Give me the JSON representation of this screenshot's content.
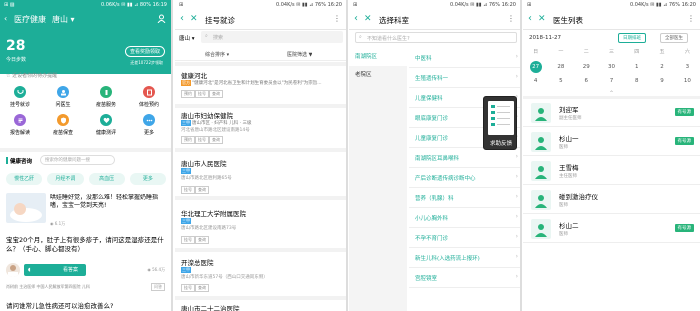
{
  "colors": {
    "teal": "#1dae98",
    "blue_tag": "#3fa6e8",
    "green": "#28b47a",
    "orange": "#f39a2d",
    "red": "#e4574f",
    "purple": "#9a67d7",
    "light_teal": "#e9f7f4"
  },
  "status_bar": {
    "p1": {
      "left": "⊞ ▨",
      "right": "0.06K/s ✉ ▮▮ ⊿ 80% 16:19"
    },
    "p2": {
      "left": "⊞",
      "right": "0.04K/s ✉ ▮▮ ⊿ 76% 16:20"
    },
    "p3": {
      "left": "⊞",
      "right": "0.04K/s ✉ ▮▮ ⊿ 76% 16:20"
    },
    "p4": {
      "left": "⊞",
      "right": "0.04K/s ✉ ▮▮ ⊿ 76% 16:20"
    }
  },
  "p1": {
    "title": "医疗健康",
    "city": "唐山",
    "temp": "28",
    "weather": "今日步数",
    "assistant_btn": "查看奖励领取",
    "assistant_sub": "还差10722步领取",
    "quick_label": "☆ 近设者你的待办提醒",
    "grid": [
      {
        "label": "挂号就诊",
        "icon": "stethoscope-icon"
      },
      {
        "label": "问医生",
        "icon": "doctor-icon"
      },
      {
        "label": "疫苗服务",
        "icon": "vaccine-icon"
      },
      {
        "label": "体检预约",
        "icon": "checkup-icon"
      },
      {
        "label": "报告解读",
        "icon": "report-icon"
      },
      {
        "label": "疫苗保查",
        "icon": "shield-icon"
      },
      {
        "label": "健康测评",
        "icon": "heart-icon"
      },
      {
        "label": "更多",
        "icon": "more-icon"
      }
    ],
    "section_title": "健康咨询",
    "search_placeholder": "搜索你的健康问题一搜",
    "tags": [
      "慢性乙肝",
      "月经不调",
      "高血压",
      "更多"
    ],
    "article1_title": "哄娃睡好觉，没那么难！轻松掌握奶睡指嗜，宝宝一觉到天亮!",
    "article1_meta": "◉ 6.1万",
    "article2_title": "宝宝20个月，肚子上有很多疹子，请问这是湿疹还是什么？（手心、脚心都没有）",
    "article2_btn": "看答案",
    "article2_count": "◉ 56.4万",
    "doctor_line": "肖树前  主治医师  中国人民解放军第四医院  儿科",
    "doctor_tag": "问答",
    "article3_title": "请问谁常儿急性病还可以治愈改善么?"
  },
  "p2": {
    "title": "挂号就诊",
    "city": "唐山",
    "search_placeholder": "搜索",
    "filter1": "综合排序 ▾",
    "filter2": "医院筛选 ▼",
    "hospitals": [
      {
        "name": "健康河北",
        "tag": "官方",
        "desc": "\"健康河北\"是河北省卫生和计划生育委员会以\"为民卷利\"为宗旨...",
        "chips": [
          "预约",
          "挂号",
          "查询"
        ]
      },
      {
        "name": "唐山市妇幼保健院",
        "tag": "三甲",
        "desc": "唐山市区 · 妇产科 儿科 · 三级",
        "addr": "河北省唐山市路北区建设南路14号",
        "chips": [
          "预约",
          "挂号",
          "查询"
        ]
      },
      {
        "name": "唐山市人民医院",
        "tag": "三甲",
        "addr": "唐山市路北区胜利路65号",
        "chips": [
          "挂号",
          "查询"
        ]
      },
      {
        "name": "华北理工大学附属医院",
        "tag": "三甲",
        "addr": "唐山市路北区建设南路73号",
        "chips": [
          "挂号",
          "查询"
        ]
      },
      {
        "name": "开滦总医院",
        "tag": "三甲",
        "addr": "唐山市新华东道57号（西山口交通岗东侧）",
        "chips": [
          "挂号",
          "查询"
        ]
      },
      {
        "name": "唐山市二十二治医院",
        "tag": ""
      }
    ]
  },
  "p3": {
    "title": "选择科室",
    "search_placeholder": "不知道看什么医生?",
    "areas": [
      "南湖院区",
      "老院区"
    ],
    "depts": [
      "中医科",
      "生殖遗传科一",
      "儿童保健科",
      "眼底康复门诊",
      "儿童康复门诊",
      "南湖院区耳鼻喉科",
      "产后诊断遗传病诊断中心",
      "营养（乳腺）科",
      "小儿心胸外科",
      "不孕不育门诊",
      "新生儿科(入选药流上报环)",
      "宫腔镜室"
    ],
    "help_label": "求助反馈"
  },
  "p4": {
    "title": "医生列表",
    "date": "2018-11-27",
    "btn_today": "日期排班",
    "btn_all": "全部医生",
    "week": [
      "日",
      "一",
      "二",
      "三",
      "四",
      "五",
      "六"
    ],
    "days1": [
      "",
      "",
      "",
      "",
      "",
      "",
      "1"
    ],
    "days2": [
      "27",
      "28",
      "29",
      "30",
      "1",
      "2",
      "3"
    ],
    "days3": [
      "4",
      "5",
      "6",
      "7",
      "8",
      "9",
      "10"
    ],
    "doctors": [
      {
        "name": "刘迎军",
        "title": "副主任医师",
        "badge": "有号源"
      },
      {
        "name": "杉山一",
        "title": "医师",
        "badge": "有号源"
      },
      {
        "name": "王雪梅",
        "title": "主任医师",
        "badge": ""
      },
      {
        "name": "碰到激治疗仪",
        "title": "医师",
        "badge": ""
      },
      {
        "name": "杉山二",
        "title": "医师",
        "badge": "有号源"
      }
    ]
  }
}
